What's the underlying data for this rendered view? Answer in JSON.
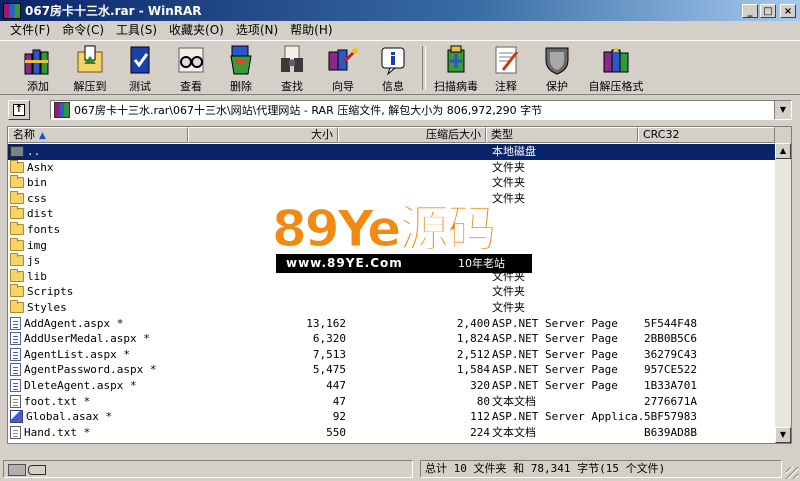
{
  "window": {
    "title": "067房卡十三水.rar - WinRAR"
  },
  "menu": [
    "文件(F)",
    "命令(C)",
    "工具(S)",
    "收藏夹(O)",
    "选项(N)",
    "帮助(H)"
  ],
  "toolbar": [
    {
      "label": "添加",
      "icon": "add-books-icon"
    },
    {
      "label": "解压到",
      "icon": "extract-folder-icon"
    },
    {
      "label": "测试",
      "icon": "test-book-icon"
    },
    {
      "label": "查看",
      "icon": "view-glasses-icon"
    },
    {
      "label": "删除",
      "icon": "delete-bin-icon"
    },
    {
      "label": "查找",
      "icon": "find-binoculars-icon"
    },
    {
      "label": "向导",
      "icon": "wizard-icon"
    },
    {
      "label": "信息",
      "icon": "info-icon"
    },
    {
      "label": "扫描病毒",
      "icon": "scan-virus-icon"
    },
    {
      "label": "注释",
      "icon": "comment-icon"
    },
    {
      "label": "保护",
      "icon": "protect-shield-icon"
    },
    {
      "label": "自解压格式",
      "icon": "sfx-icon"
    }
  ],
  "address": {
    "path": "067房卡十三水.rar\\067十三水\\网站\\代理网站 - RAR 压缩文件, 解包大小为 806,972,290 字节"
  },
  "columns": {
    "name": "名称",
    "size": "大小",
    "packed": "压缩后大小",
    "type": "类型",
    "crc": "CRC32"
  },
  "files": [
    {
      "name": "..",
      "size": "",
      "packed": "",
      "type": "本地磁盘",
      "crc": "",
      "icon": "updir",
      "selected": true
    },
    {
      "name": "Ashx",
      "size": "",
      "packed": "",
      "type": "文件夹",
      "crc": "",
      "icon": "folder"
    },
    {
      "name": "bin",
      "size": "",
      "packed": "",
      "type": "文件夹",
      "crc": "",
      "icon": "folder"
    },
    {
      "name": "css",
      "size": "",
      "packed": "",
      "type": "文件夹",
      "crc": "",
      "icon": "folder"
    },
    {
      "name": "dist",
      "size": "",
      "packed": "",
      "type": "",
      "crc": "",
      "icon": "folder"
    },
    {
      "name": "fonts",
      "size": "",
      "packed": "",
      "type": "",
      "crc": "",
      "icon": "folder"
    },
    {
      "name": "img",
      "size": "",
      "packed": "",
      "type": "",
      "crc": "",
      "icon": "folder"
    },
    {
      "name": "js",
      "size": "",
      "packed": "",
      "type": "",
      "crc": "",
      "icon": "folder"
    },
    {
      "name": "lib",
      "size": "",
      "packed": "",
      "type": "文件夹",
      "crc": "",
      "icon": "folder"
    },
    {
      "name": "Scripts",
      "size": "",
      "packed": "",
      "type": "文件夹",
      "crc": "",
      "icon": "folder"
    },
    {
      "name": "Styles",
      "size": "",
      "packed": "",
      "type": "文件夹",
      "crc": "",
      "icon": "folder"
    },
    {
      "name": "AddAgent.aspx *",
      "size": "13,162",
      "packed": "2,400",
      "type": "ASP.NET Server Page",
      "crc": "5F544F48",
      "icon": "aspx"
    },
    {
      "name": "AddUserMedal.aspx *",
      "size": "6,320",
      "packed": "1,824",
      "type": "ASP.NET Server Page",
      "crc": "2BB0B5C6",
      "icon": "aspx"
    },
    {
      "name": "AgentList.aspx *",
      "size": "7,513",
      "packed": "2,512",
      "type": "ASP.NET Server Page",
      "crc": "36279C43",
      "icon": "aspx"
    },
    {
      "name": "AgentPassword.aspx *",
      "size": "5,475",
      "packed": "1,584",
      "type": "ASP.NET Server Page",
      "crc": "957CE522",
      "icon": "aspx"
    },
    {
      "name": "DleteAgent.aspx *",
      "size": "447",
      "packed": "320",
      "type": "ASP.NET Server Page",
      "crc": "1B33A701",
      "icon": "aspx"
    },
    {
      "name": "foot.txt *",
      "size": "47",
      "packed": "80",
      "type": "文本文档",
      "crc": "2776671A",
      "icon": "txt"
    },
    {
      "name": "Global.asax *",
      "size": "92",
      "packed": "112",
      "type": "ASP.NET Server Applica...",
      "crc": "5BF57983",
      "icon": "asax"
    },
    {
      "name": "Hand.txt *",
      "size": "550",
      "packed": "224",
      "type": "文本文档",
      "crc": "B639AD8B",
      "icon": "txt"
    }
  ],
  "watermark": {
    "big": "89Ye源码",
    "url": "www.89YE.Com",
    "tag": "10年老站"
  },
  "status": {
    "summary": "总计 10 文件夹 和 78,341 字节(15 个文件)"
  },
  "colors": {
    "selection": "#0a246a",
    "titlebar": "#0a246a",
    "watermark": "#f08a10"
  }
}
